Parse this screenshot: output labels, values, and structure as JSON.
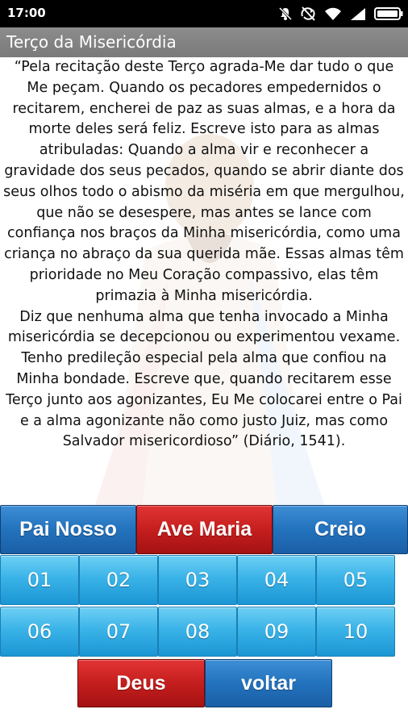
{
  "status": {
    "time": "17:00"
  },
  "icons": [
    "mute-icon",
    "sync-off-icon",
    "wifi-icon",
    "signal-icon",
    "battery-icon"
  ],
  "appbar": {
    "title": "Terço da Misericórdia"
  },
  "content": {
    "paragraphs": [
      "“Pela recitação deste Terço agrada-Me dar tudo o que Me peçam. Quando os pecadores empedernidos o recitarem, encherei de paz as suas almas, e a hora da morte deles será feliz. Escreve isto para as almas atribuladas: Quando a alma vir e reconhecer a gravidade dos seus pecados, quando se abrir diante dos seus olhos todo o abismo da miséria em que mergulhou, que não se desespere, mas antes se lance com confiança nos braços da Minha misericórdia, como uma criança no abraço da sua querida mãe. Essas almas têm prioridade no Meu Coração compassivo, elas têm primazia à Minha misericórdia.",
      "Diz que nenhuma alma que tenha invocado a Minha misericórdia se decepcionou ou experimentou vexame. Tenho predileção especial pela alma que confiou na Minha bondade. Escreve que, quando recitarem esse Terço junto aos agonizantes, Eu Me colocarei entre o Pai e a alma agonizante não como justo Juiz, mas como Salvador misericordioso” (Diário, 1541)."
    ]
  },
  "buttons": {
    "pai_nosso": "Pai Nosso",
    "ave_maria": "Ave Maria",
    "creio": "Creio",
    "numbers": [
      "01",
      "02",
      "03",
      "04",
      "05",
      "06",
      "07",
      "08",
      "09",
      "10"
    ],
    "deus": "Deus",
    "voltar": "voltar"
  },
  "colors": {
    "blue_button": "#2474bf",
    "red_button": "#c51e1e",
    "number_button": "#3ab3e8",
    "appbar": "#828282"
  }
}
